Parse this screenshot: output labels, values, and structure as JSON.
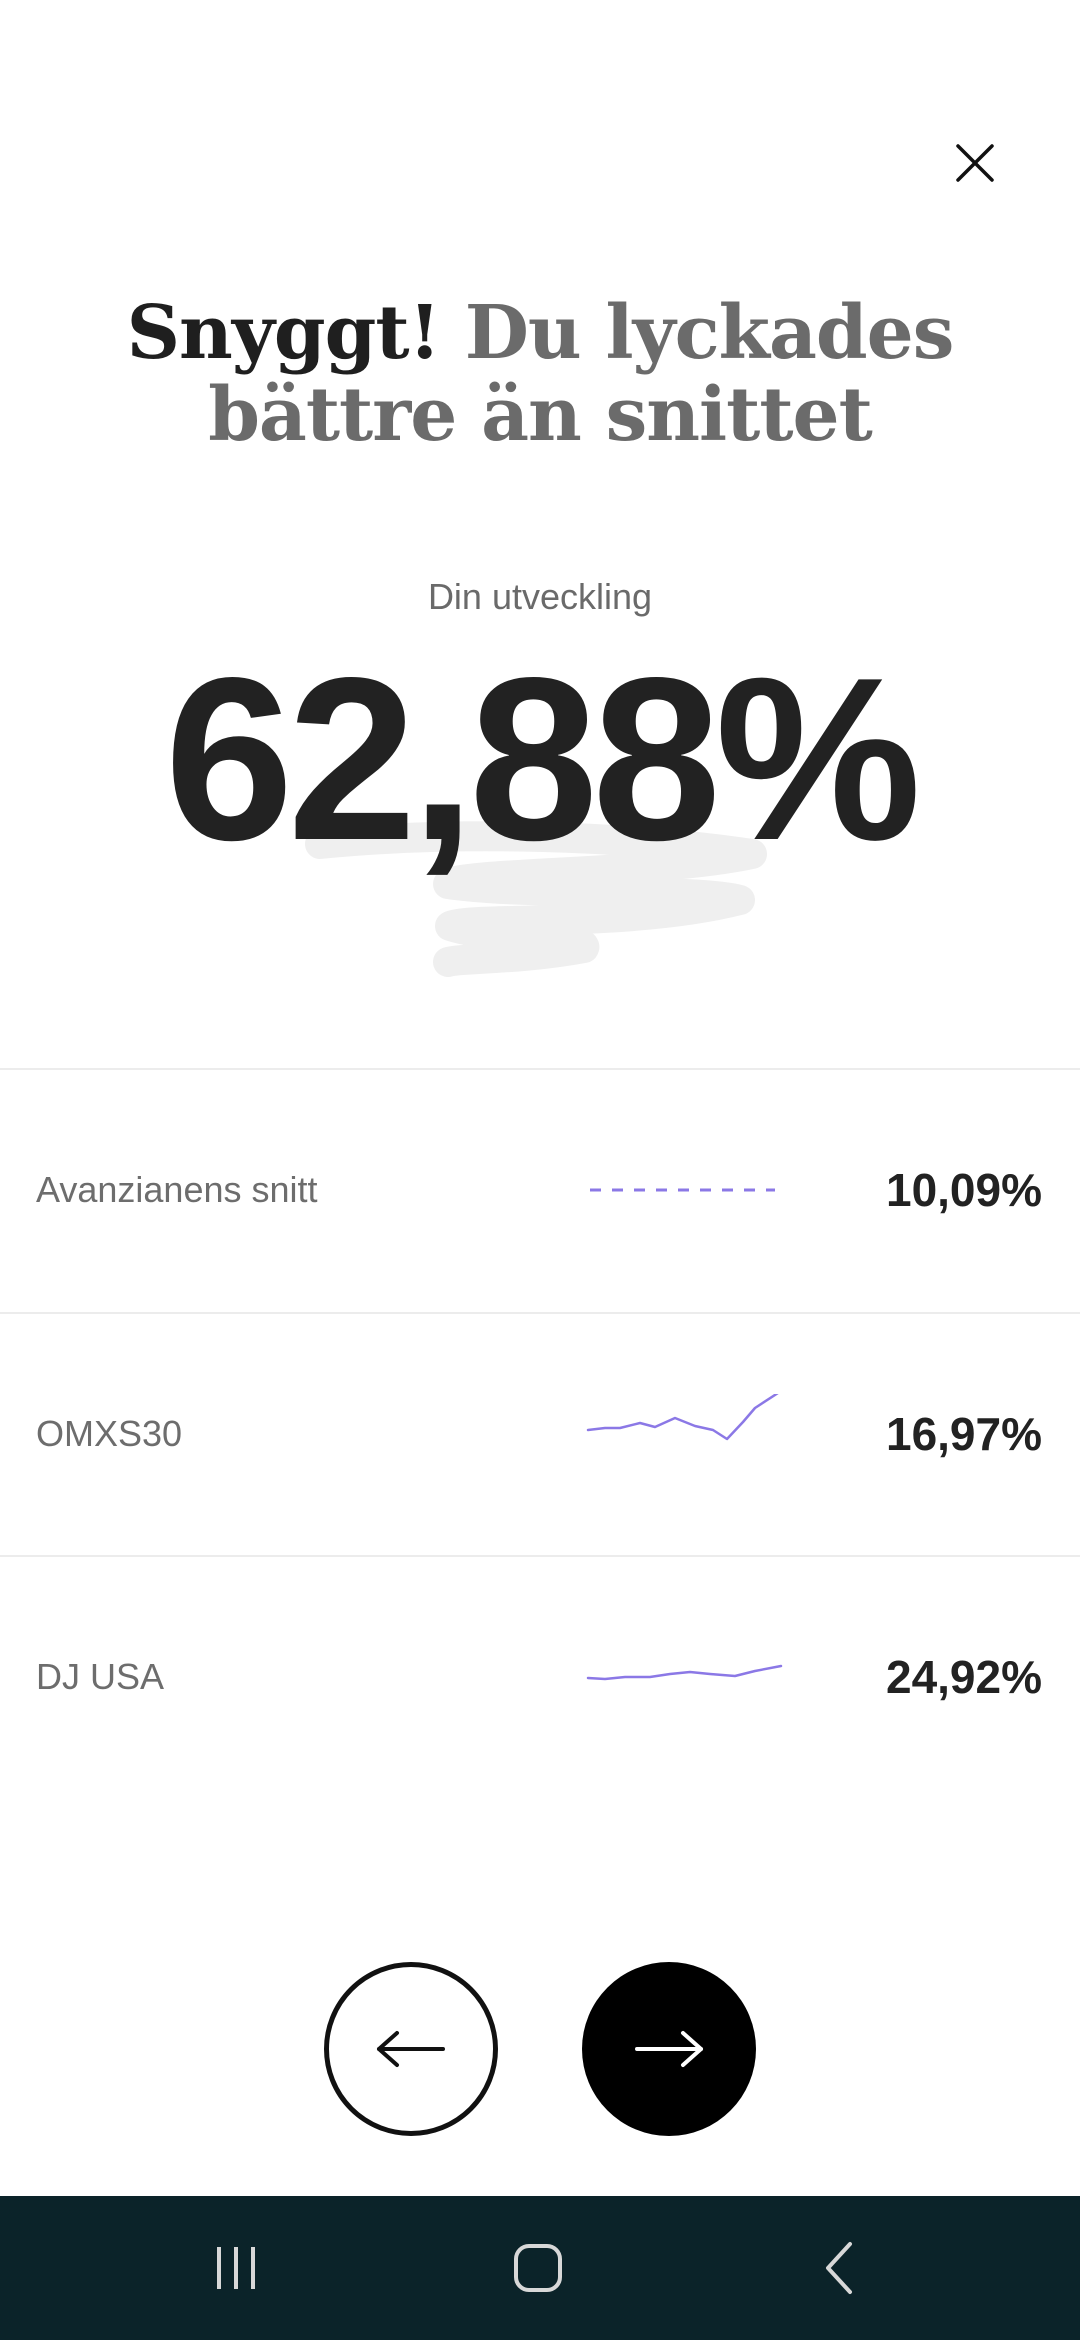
{
  "headline": {
    "strong": "Snyggt!",
    "soft_line1": " Du lyckades",
    "soft_line2": "bättre än snittet"
  },
  "development": {
    "label": "Din utveckling",
    "value": "62,88%"
  },
  "comparisons": [
    {
      "label": "Avanzianens snitt",
      "value": "10,09%",
      "spark": "dashed"
    },
    {
      "label": "OMXS30",
      "value": "16,97%",
      "spark": "line"
    },
    {
      "label": "DJ USA",
      "value": "24,92%",
      "spark": "line"
    }
  ],
  "colors": {
    "accent": "#8b78e6",
    "text_dark": "#222222",
    "text_muted": "#6d6d6d",
    "system_bar": "#0b2329"
  },
  "icons": {
    "close": "close-icon",
    "prev": "arrow-left-icon",
    "next": "arrow-right-icon",
    "recents": "recents-icon",
    "home": "home-icon",
    "back": "back-icon"
  }
}
